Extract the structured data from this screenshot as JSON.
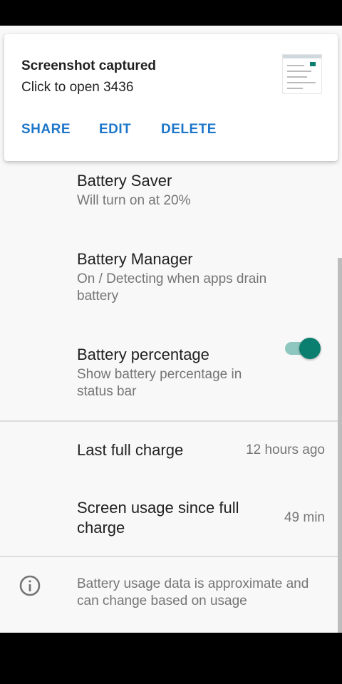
{
  "notification": {
    "title": "Screenshot captured",
    "text": "Click to open 3436",
    "actions": {
      "share": "SHARE",
      "edit": "EDIT",
      "delete": "DELETE"
    }
  },
  "settings": {
    "battery_saver": {
      "title": "Battery Saver",
      "summary": "Will turn on at 20%"
    },
    "battery_manager": {
      "title": "Battery Manager",
      "summary": "On / Detecting when apps drain battery"
    },
    "battery_percentage": {
      "title": "Battery percentage",
      "summary": "Show battery percentage in status bar",
      "enabled": true
    },
    "last_full_charge": {
      "title": "Last full charge",
      "value": "12 hours ago"
    },
    "screen_usage": {
      "title": "Screen usage since full charge",
      "value": "49 min"
    }
  },
  "footer": {
    "text": "Battery usage data is approximate and can change based on usage"
  },
  "colors": {
    "accent": "#0b7f6f",
    "action": "#1e76c9"
  }
}
